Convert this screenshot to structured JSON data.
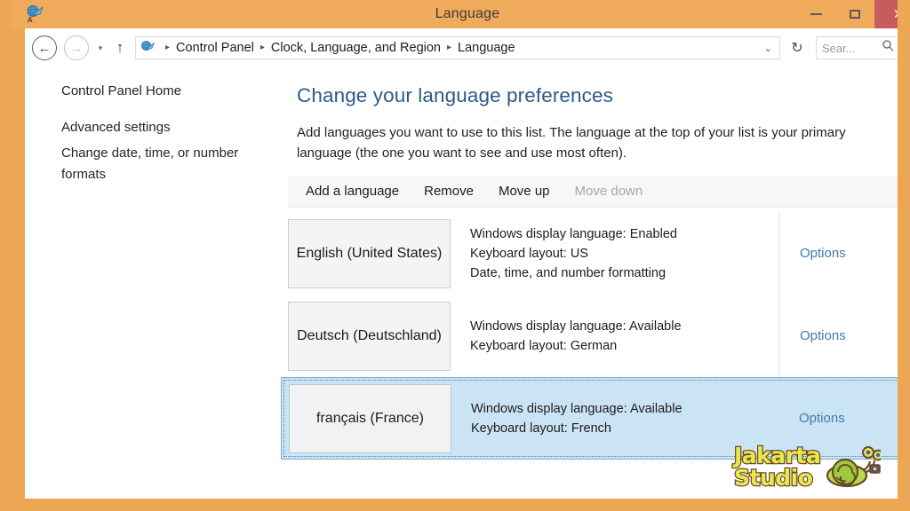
{
  "window": {
    "title": "Language",
    "icon": "language-globe-icon",
    "frame_color": "#eda654",
    "titlebar_color": "#f0aa5c",
    "close_button_color": "#c75c5c",
    "controls": {
      "minimize": "minimize-icon",
      "maximize": "maximize-icon",
      "close": "×"
    }
  },
  "navbar": {
    "back": "←",
    "forward": "→",
    "history_dropdown": "▾",
    "up": "↑",
    "breadcrumb": [
      "Control Panel",
      "Clock, Language, and Region",
      "Language"
    ],
    "breadcrumb_separator": "▸",
    "address_chevron": "⌄",
    "refresh": "↻",
    "search_placeholder": "Sear..."
  },
  "sidebar": {
    "items": [
      {
        "label": "Control Panel Home"
      },
      {
        "label": "Advanced settings"
      },
      {
        "label": "Change date, time, or number formats"
      }
    ]
  },
  "main": {
    "title": "Change your language preferences",
    "description": "Add languages you want to use to this list. The language at the top of your list is your primary language (the one you want to see and use most often).",
    "toolbar": [
      {
        "label": "Add a language",
        "enabled": true
      },
      {
        "label": "Remove",
        "enabled": true
      },
      {
        "label": "Move up",
        "enabled": true
      },
      {
        "label": "Move down",
        "enabled": false
      }
    ],
    "languages": [
      {
        "name": "English (United States)",
        "display_language": "Windows display language: Enabled",
        "keyboard_layout": "Keyboard layout: US",
        "extra": "Date, time, and number formatting",
        "options_label": "Options",
        "selected": false
      },
      {
        "name": "Deutsch (Deutschland)",
        "display_language": "Windows display language: Available",
        "keyboard_layout": "Keyboard layout: German",
        "extra": "",
        "options_label": "Options",
        "selected": false
      },
      {
        "name": "français (France)",
        "display_language": "Windows display language: Available",
        "keyboard_layout": "Keyboard layout: French",
        "extra": "",
        "options_label": "Options",
        "selected": true
      }
    ]
  },
  "watermark": {
    "line1": "Jakarta",
    "line2": "Studio",
    "mascot": "snail-with-camera-icon"
  }
}
